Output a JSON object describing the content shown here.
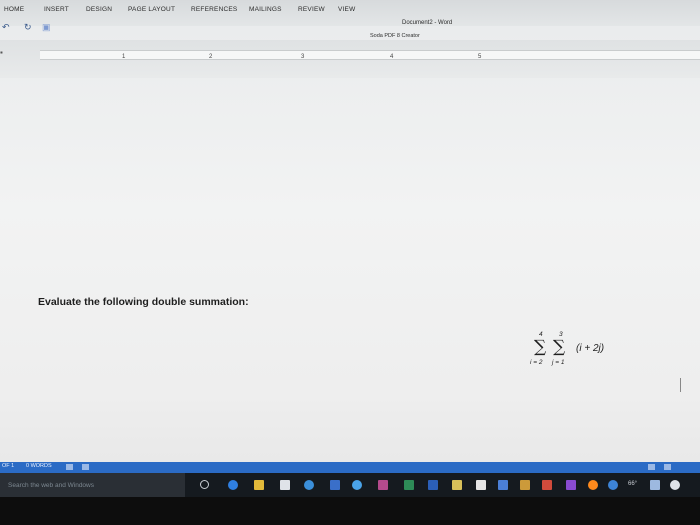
{
  "window": {
    "title": "Document2 - Word",
    "addin": "Soda PDF 8 Creator"
  },
  "ribbon": {
    "tabs": [
      "HOME",
      "INSERT",
      "DESIGN",
      "PAGE LAYOUT",
      "REFERENCES",
      "MAILINGS",
      "REVIEW",
      "VIEW"
    ]
  },
  "ruler": {
    "numbers": [
      "1",
      "2",
      "3",
      "4",
      "5"
    ]
  },
  "document": {
    "prompt": "Evaluate the following double summation:",
    "equation": {
      "outer_upper": "4",
      "outer_lower": "i = 2",
      "inner_upper": "3",
      "inner_lower": "j = 1",
      "summand": "(i + 2j)"
    }
  },
  "statusbar": {
    "page": "OF 1",
    "words": "0 WORDS"
  },
  "taskbar": {
    "search_placeholder": "Search the web and Windows",
    "clock": "66°"
  },
  "colors": {
    "status_bar": "#2b6bc5",
    "taskbar": "#151a1f"
  }
}
